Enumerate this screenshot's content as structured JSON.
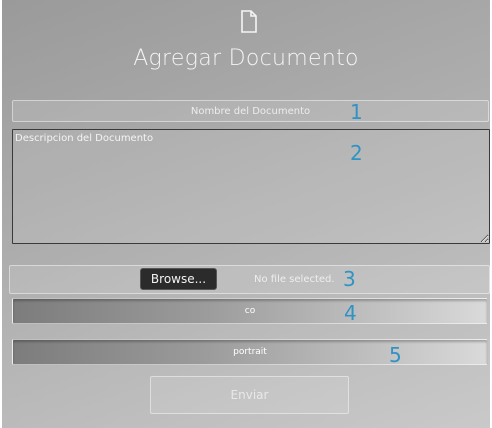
{
  "form": {
    "title": "Agregar Documento",
    "icon": "document-icon",
    "name_placeholder": "Nombre del Documento",
    "description_placeholder": "Descripcion del Documento",
    "browse_label": "Browse...",
    "file_status": "No file selected.",
    "co_select_value": "co",
    "orientation_select_value": "portrait",
    "submit_label": "Enviar"
  },
  "markers": [
    "1",
    "2",
    "3",
    "4",
    "5"
  ],
  "colors": {
    "marker": "#2f93c4",
    "panel_gradient_start": "#9a9a9a",
    "panel_gradient_end": "#c9c9c9"
  }
}
